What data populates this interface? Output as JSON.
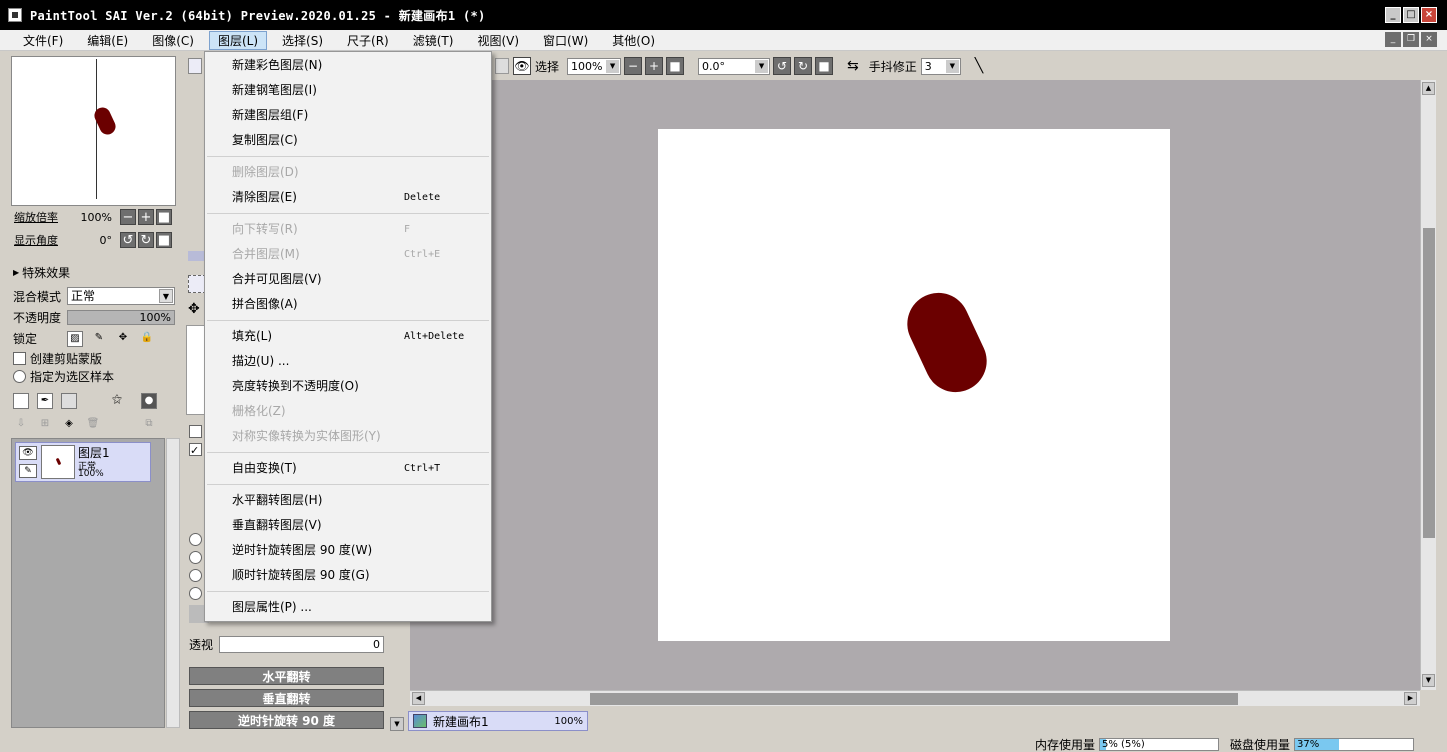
{
  "window": {
    "title": "PaintTool SAI Ver.2 (64bit) Preview.2020.01.25 - 新建画布1 (*)"
  },
  "menubar": {
    "items": [
      "文件(F)",
      "编辑(E)",
      "图像(C)",
      "图层(L)",
      "选择(S)",
      "尺子(R)",
      "滤镜(T)",
      "视图(V)",
      "窗口(W)",
      "其他(O)"
    ],
    "active_index": 3
  },
  "navigator": {
    "zoom_label": "缩放倍率",
    "zoom_value": "100%",
    "angle_label": "显示角度",
    "angle_value": "0°"
  },
  "layer_panel": {
    "effects_label": "特殊效果",
    "blend_label": "混合模式",
    "blend_value": "正常",
    "opacity_label": "不透明度",
    "opacity_value": "100%",
    "lock_label": "锁定",
    "clip_label": "创建剪贴蒙版",
    "selection_source_label": "指定为选区样本",
    "layer": {
      "name": "图层1",
      "mode": "正常",
      "opacity": "100%"
    }
  },
  "tool_panel": {
    "transparency_label": "透视",
    "transparency_value": "0",
    "buttons": [
      "水平翻转",
      "垂直翻转",
      "逆时针旋转 90 度"
    ]
  },
  "toolbar": {
    "select_label": "选择",
    "zoom": "100%",
    "angle": "0.0°",
    "stabilizer_label": "手抖修正",
    "stabilizer_value": "3"
  },
  "layer_menu": {
    "items": [
      {
        "label": "新建彩色图层(N)",
        "shortcut": "",
        "enabled": true
      },
      {
        "label": "新建钢笔图层(I)",
        "shortcut": "",
        "enabled": true
      },
      {
        "label": "新建图层组(F)",
        "shortcut": "",
        "enabled": true
      },
      {
        "label": "复制图层(C)",
        "shortcut": "",
        "enabled": true
      },
      {
        "label": "删除图层(D)",
        "shortcut": "",
        "enabled": false
      },
      {
        "label": "清除图层(E)",
        "shortcut": "Delete",
        "enabled": true
      },
      {
        "label": "向下转写(R)",
        "shortcut": "F",
        "enabled": false
      },
      {
        "label": "合并图层(M)",
        "shortcut": "Ctrl+E",
        "enabled": false
      },
      {
        "label": "合并可见图层(V)",
        "shortcut": "",
        "enabled": true
      },
      {
        "label": "拼合图像(A)",
        "shortcut": "",
        "enabled": true
      },
      {
        "label": "填充(L)",
        "shortcut": "Alt+Delete",
        "enabled": true
      },
      {
        "label": "描边(U) ...",
        "shortcut": "",
        "enabled": true
      },
      {
        "label": "亮度转换到不透明度(O)",
        "shortcut": "",
        "enabled": true
      },
      {
        "label": "栅格化(Z)",
        "shortcut": "",
        "enabled": false
      },
      {
        "label": "对称实像转换为实体图形(Y)",
        "shortcut": "",
        "enabled": false
      },
      {
        "label": "自由变换(T)",
        "shortcut": "Ctrl+T",
        "enabled": true
      },
      {
        "label": "水平翻转图层(H)",
        "shortcut": "",
        "enabled": true
      },
      {
        "label": "垂直翻转图层(V)",
        "shortcut": "",
        "enabled": true
      },
      {
        "label": "逆时针旋转图层 90 度(W)",
        "shortcut": "",
        "enabled": true
      },
      {
        "label": "顺时针旋转图层 90 度(G)",
        "shortcut": "",
        "enabled": true
      },
      {
        "label": "图层属性(P) ...",
        "shortcut": "",
        "enabled": true
      }
    ]
  },
  "document_tab": {
    "name": "新建画布1",
    "zoom": "100%"
  },
  "status": {
    "memory_label": "内存使用量",
    "memory_value": "5% (5%)",
    "memory_fraction": 0.05,
    "disk_label": "磁盘使用量",
    "disk_value": "37%",
    "disk_fraction": 0.37
  },
  "colors": {
    "stroke": "#6b0000",
    "menu_highlight": "#cce4f7",
    "layer_selected": "#d9dcf7"
  }
}
